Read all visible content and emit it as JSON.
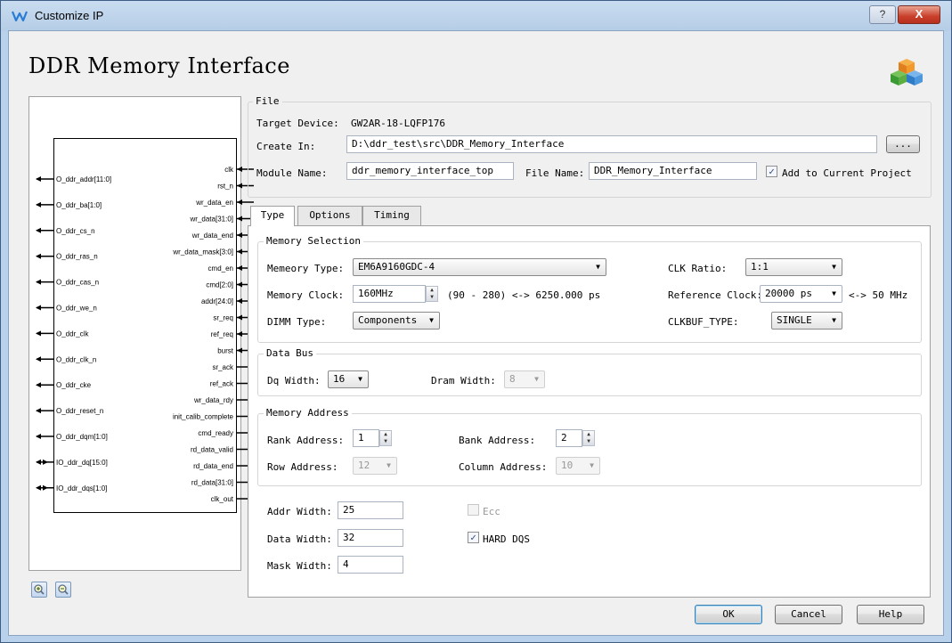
{
  "window": {
    "title": "Customize IP",
    "help_glyph": "?",
    "close_glyph": "X"
  },
  "heading": "DDR Memory Interface",
  "icons": {
    "app": "gowin-logo-icon",
    "ip": "ip-cubes-icon",
    "zoom_in": "zoom-in-icon",
    "zoom_out": "zoom-out-icon"
  },
  "symbol": {
    "left_pins": [
      {
        "name": "O_ddr_addr[11:0]",
        "dir": "out"
      },
      {
        "name": "O_ddr_ba[1:0]",
        "dir": "out"
      },
      {
        "name": "O_ddr_cs_n",
        "dir": "out"
      },
      {
        "name": "O_ddr_ras_n",
        "dir": "out"
      },
      {
        "name": "O_ddr_cas_n",
        "dir": "out"
      },
      {
        "name": "O_ddr_we_n",
        "dir": "out"
      },
      {
        "name": "O_ddr_clk",
        "dir": "out"
      },
      {
        "name": "O_ddr_clk_n",
        "dir": "out"
      },
      {
        "name": "O_ddr_cke",
        "dir": "out"
      },
      {
        "name": "O_ddr_reset_n",
        "dir": "out"
      },
      {
        "name": "O_ddr_dqm[1:0]",
        "dir": "out"
      },
      {
        "name": "IO_ddr_dq[15:0]",
        "dir": "inout"
      },
      {
        "name": "IO_ddr_dqs[1:0]",
        "dir": "inout"
      }
    ],
    "right_pins": [
      {
        "name": "clk",
        "dir": "in"
      },
      {
        "name": "rst_n",
        "dir": "in"
      },
      {
        "name": "wr_data_en",
        "dir": "in"
      },
      {
        "name": "wr_data[31:0]",
        "dir": "in"
      },
      {
        "name": "wr_data_end",
        "dir": "in"
      },
      {
        "name": "wr_data_mask[3:0]",
        "dir": "in"
      },
      {
        "name": "cmd_en",
        "dir": "in"
      },
      {
        "name": "cmd[2:0]",
        "dir": "in"
      },
      {
        "name": "addr[24:0]",
        "dir": "in"
      },
      {
        "name": "sr_req",
        "dir": "in"
      },
      {
        "name": "ref_req",
        "dir": "in"
      },
      {
        "name": "burst",
        "dir": "in"
      },
      {
        "name": "sr_ack",
        "dir": "out"
      },
      {
        "name": "ref_ack",
        "dir": "out"
      },
      {
        "name": "wr_data_rdy",
        "dir": "out"
      },
      {
        "name": "init_calib_complete",
        "dir": "out"
      },
      {
        "name": "cmd_ready",
        "dir": "out"
      },
      {
        "name": "rd_data_valid",
        "dir": "out"
      },
      {
        "name": "rd_data_end",
        "dir": "out"
      },
      {
        "name": "rd_data[31:0]",
        "dir": "out"
      },
      {
        "name": "clk_out",
        "dir": "out"
      }
    ]
  },
  "file": {
    "group_title": "File",
    "target_device_label": "Target Device:",
    "target_device_value": "GW2AR-18-LQFP176",
    "create_in_label": "Create In:",
    "create_in_value": "D:\\ddr_test\\src\\DDR_Memory_Interface",
    "browse_label": "...",
    "module_name_label": "Module Name:",
    "module_name_value": "ddr_memory_interface_top",
    "file_name_label": "File Name:",
    "file_name_value": "DDR_Memory_Interface",
    "add_to_project_label": "Add to Current Project",
    "add_to_project_checked": true
  },
  "tabs": [
    {
      "label": "Type",
      "active": true
    },
    {
      "label": "Options",
      "active": false
    },
    {
      "label": "Timing",
      "active": false
    }
  ],
  "memory_selection": {
    "title": "Memory Selection",
    "memory_type_label": "Memeory Type:",
    "memory_type_value": "EM6A9160GDC-4",
    "clk_ratio_label": "CLK Ratio:",
    "clk_ratio_value": "1:1",
    "memory_clock_label": "Memory Clock:",
    "memory_clock_value": "160MHz",
    "memory_clock_info": "(90 - 280) <-> 6250.000 ps",
    "reference_clock_label": "Reference Clock:",
    "reference_clock_value": "20000 ps",
    "reference_clock_info": "<-> 50 MHz",
    "dimm_type_label": "DIMM Type:",
    "dimm_type_value": "Components",
    "clkbuf_type_label": "CLKBUF_TYPE:",
    "clkbuf_type_value": "SINGLE"
  },
  "data_bus": {
    "title": "Data Bus",
    "dq_width_label": "Dq Width:",
    "dq_width_value": "16",
    "dram_width_label": "Dram Width:",
    "dram_width_value": "8"
  },
  "memory_address": {
    "title": "Memory Address",
    "rank_address_label": "Rank Address:",
    "rank_address_value": "1",
    "bank_address_label": "Bank Address:",
    "bank_address_value": "2",
    "row_address_label": "Row Address:",
    "row_address_value": "12",
    "column_address_label": "Column Address:",
    "column_address_value": "10"
  },
  "widths": {
    "addr_width_label": "Addr Width:",
    "addr_width_value": "25",
    "data_width_label": "Data Width:",
    "data_width_value": "32",
    "mask_width_label": "Mask Width:",
    "mask_width_value": "4",
    "ecc_label": "Ecc",
    "ecc_checked": false,
    "hard_dqs_label": "HARD DQS",
    "hard_dqs_checked": true
  },
  "footer": {
    "ok_label": "OK",
    "cancel_label": "Cancel",
    "help_label": "Help"
  }
}
